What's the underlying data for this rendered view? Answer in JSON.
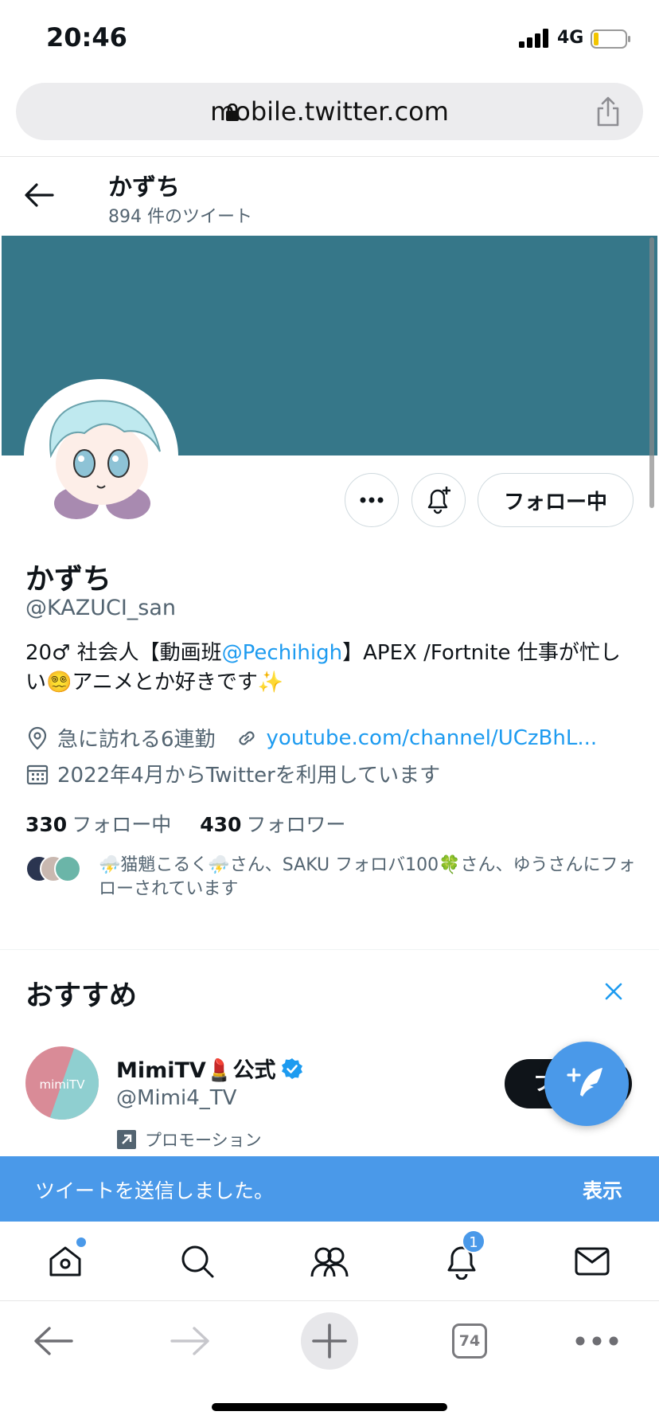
{
  "status_bar": {
    "time": "20:46",
    "network": "4G"
  },
  "browser": {
    "url": "mobile.twitter.com",
    "tab_count": "74"
  },
  "header": {
    "name": "かずち",
    "tweet_count": "894 件のツイート"
  },
  "colors": {
    "banner": "#367789",
    "accent": "#1d9bf0",
    "toast": "#4a99e9"
  },
  "profile": {
    "follow_button": "フォロー中",
    "name": "かずち",
    "handle": "@KAZUCI_san",
    "bio_part1": "20♂ 社会人【動画班",
    "bio_mention": "@Pechihigh",
    "bio_part2": "】APEX /Fortnite 仕事が忙しい😵‍💫アニメとか好きです✨",
    "location": "急に訪れる6連勤",
    "link": "youtube.com/channel/UCzBhL...",
    "joined": "2022年4月からTwitterを利用しています",
    "following_count": "330",
    "following_label": "フォロー中",
    "followers_count": "430",
    "followers_label": "フォロワー",
    "followed_by": "⛈️猫魈こるく⛈️さん、SAKU フォロバ100🍀さん、ゆうさんにフォローされています"
  },
  "recommendations": {
    "title": "おすすめ",
    "items": [
      {
        "avatar_text": "mimiTV",
        "name": "MimiTV💄公式",
        "handle": "@Mimi4_TV",
        "promo": "プロモーション",
        "follow_label": "フ"
      }
    ]
  },
  "toast": {
    "text": "ツイートを送信しました。",
    "action": "表示"
  },
  "tabbar": {
    "notifications_badge": "1"
  },
  "icons": [
    "lock-icon",
    "share-icon",
    "back-arrow-icon",
    "more-icon",
    "bell-plus-icon",
    "location-icon",
    "link-icon",
    "calendar-icon",
    "close-icon",
    "verified-icon",
    "promoted-icon",
    "compose-icon",
    "home-icon",
    "search-icon",
    "communities-icon",
    "notifications-icon",
    "messages-icon",
    "browser-back-icon",
    "browser-forward-icon",
    "new-tab-icon",
    "tabs-icon",
    "browser-menu-icon"
  ]
}
